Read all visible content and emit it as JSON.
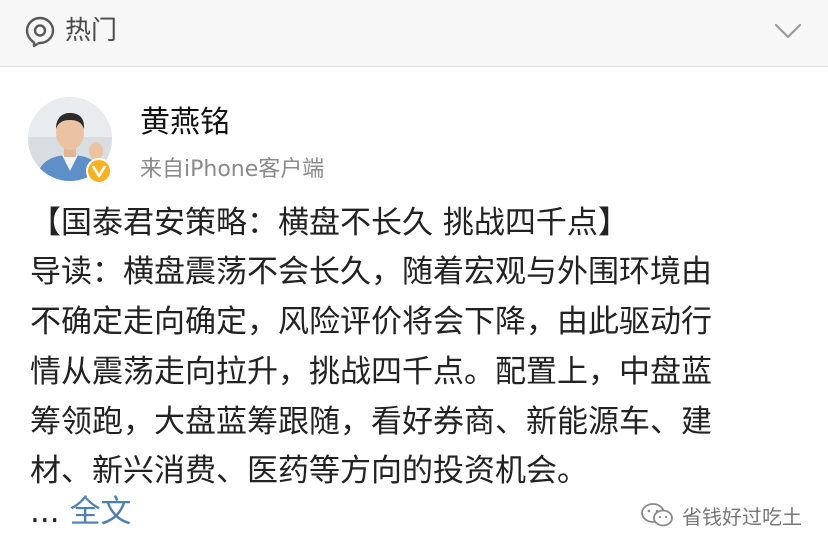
{
  "topbar": {
    "label": "热门",
    "icon": "hot-location-icon",
    "toggle_icon": "chevron-down-icon"
  },
  "post": {
    "author": "黄燕铭",
    "source": "来自iPhone客户端",
    "verified_badge": "v",
    "lines": [
      "【国泰君安策略：横盘不长久 挑战四千点】",
      "导读：横盘震荡不会长久，随着宏观与外围环境由",
      "不确定走向确定，风险评价将会下降，由此驱动行",
      "情从震荡走向拉升，挑战四千点。配置上，中盘蓝",
      "筹领跑，大盘蓝筹跟随，看好券商、新能源车、建",
      "材、新兴消费、医药等方向的投资机会。"
    ],
    "ellipsis": "...",
    "full_text_link": "全文"
  },
  "watermark": {
    "text": "省钱好过吃土",
    "icon": "wechat-icon"
  },
  "colors": {
    "link": "#4e7fb3",
    "verified": "#f5b321",
    "topbar_bg": "#f7f7f7"
  }
}
